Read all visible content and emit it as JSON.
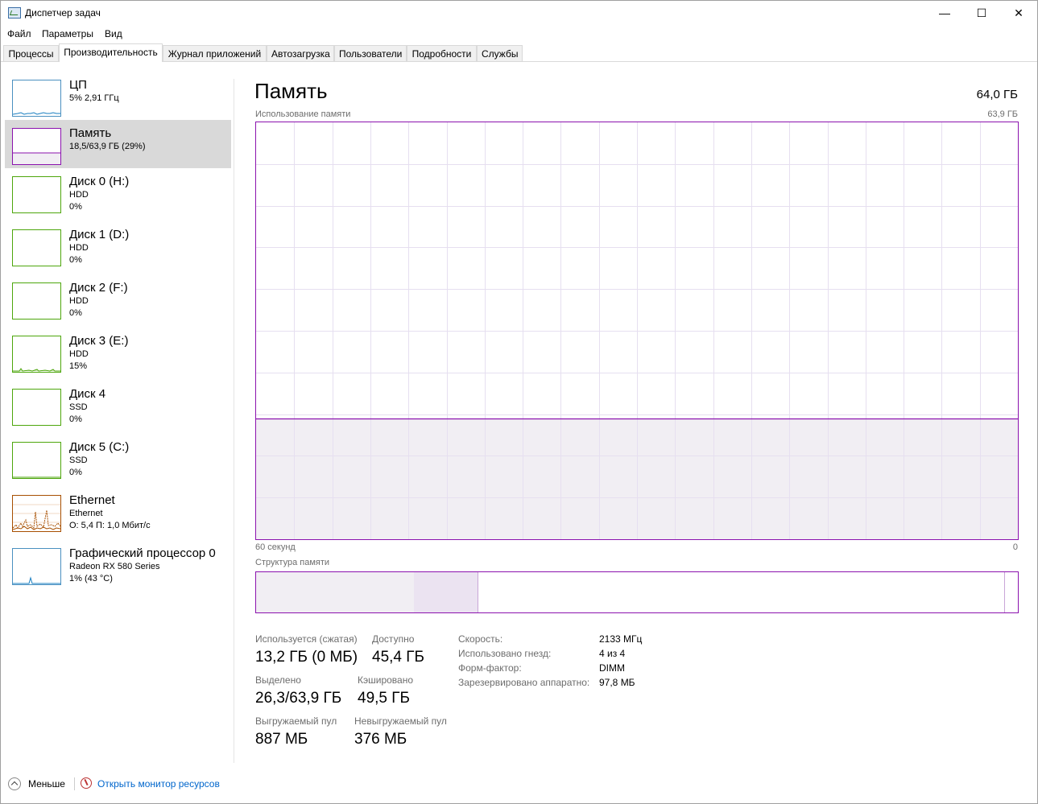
{
  "window": {
    "title": "Диспетчер задач",
    "minimize": "—",
    "maximize": "☐",
    "close": "✕"
  },
  "menu": [
    "Файл",
    "Параметры",
    "Вид"
  ],
  "tabs": [
    "Процессы",
    "Производительность",
    "Журнал приложений",
    "Автозагрузка",
    "Пользователи",
    "Подробности",
    "Службы"
  ],
  "active_tab": "Производительность",
  "sidebar": [
    {
      "name": "ЦП",
      "line1": "5% 2,91 ГГц",
      "line2": "",
      "color": "#1a7fc1"
    },
    {
      "name": "Память",
      "line1": "18,5/63,9 ГБ (29%)",
      "line2": "",
      "color": "#8b12ae",
      "selected": true
    },
    {
      "name": "Диск 0 (H:)",
      "line1": "HDD",
      "line2": "0%",
      "color": "#4da60c"
    },
    {
      "name": "Диск 1 (D:)",
      "line1": "HDD",
      "line2": "0%",
      "color": "#4da60c"
    },
    {
      "name": "Диск 2 (F:)",
      "line1": "HDD",
      "line2": "0%",
      "color": "#4da60c"
    },
    {
      "name": "Диск 3 (E:)",
      "line1": "HDD",
      "line2": "15%",
      "color": "#4da60c"
    },
    {
      "name": "Диск 4",
      "line1": "SSD",
      "line2": "0%",
      "color": "#4da60c"
    },
    {
      "name": "Диск 5 (C:)",
      "line1": "SSD",
      "line2": "0%",
      "color": "#4da60c"
    },
    {
      "name": "Ethernet",
      "line1": "Ethernet",
      "line2": "О: 5,4 П: 1,0 Мбит/с",
      "color": "#a74f01"
    },
    {
      "name": "Графический процессор 0",
      "line1": "Radeon RX 580 Series",
      "line2": "1% (43 °C)",
      "color": "#1a7fc1"
    }
  ],
  "main": {
    "title": "Память",
    "total": "64,0 ГБ",
    "graph_label": "Использование памяти",
    "graph_max": "63,9 ГБ",
    "time_left": "60 секунд",
    "time_right": "0",
    "struct_label": "Структура памяти",
    "usage_fraction": 0.29
  },
  "stats": {
    "in_use_label": "Используется (сжатая)",
    "in_use": "13,2 ГБ (0 МБ)",
    "available_label": "Доступно",
    "available": "45,4 ГБ",
    "committed_label": "Выделено",
    "committed": "26,3/63,9 ГБ",
    "cached_label": "Кэшировано",
    "cached": "49,5 ГБ",
    "paged_label": "Выгружаемый пул",
    "paged": "887 МБ",
    "nonpaged_label": "Невыгружаемый пул",
    "nonpaged": "376 МБ"
  },
  "details": [
    {
      "key": "Скорость:",
      "value": "2133 МГц"
    },
    {
      "key": "Использовано гнезд:",
      "value": "4 из 4"
    },
    {
      "key": "Форм-фактор:",
      "value": "DIMM"
    },
    {
      "key": "Зарезервировано аппаратно:",
      "value": "97,8 МБ"
    }
  ],
  "footer": {
    "less": "Меньше",
    "resmon": "Открыть монитор ресурсов"
  },
  "colors": {
    "memory": "#8b12ae",
    "grid": "#e6dff0",
    "fill": "#f1eef3"
  }
}
